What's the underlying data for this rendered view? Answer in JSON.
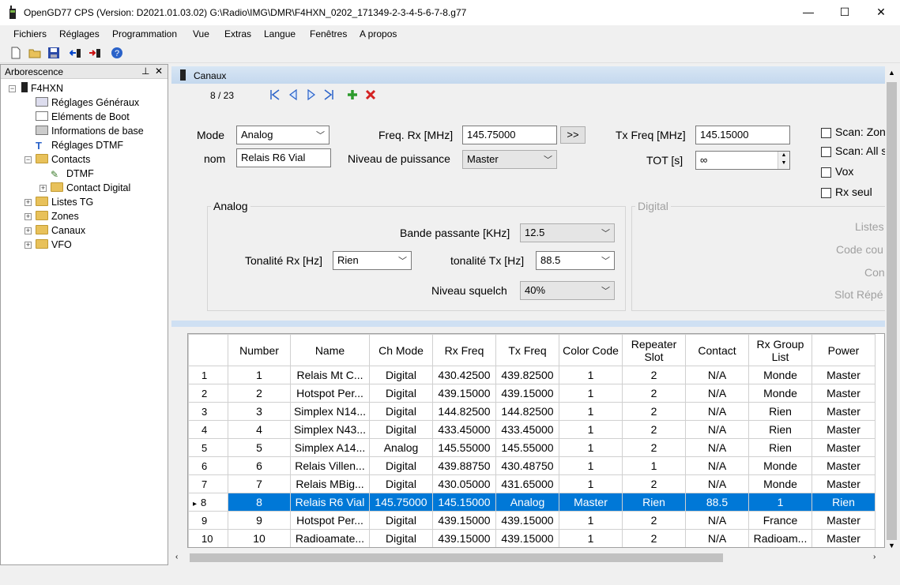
{
  "window": {
    "title": "OpenGD77 CPS (Version:  D2021.01.03.02) G:\\Radio\\IMG\\DMR\\F4HXN_0202_171349-2-3-4-5-6-7-8.g77",
    "minimize": "—",
    "maximize": "☐",
    "close": "✕"
  },
  "menu": [
    "Fichiers",
    "Réglages",
    "Programmation",
    "Vue",
    "Extras",
    "Langue",
    "Fenêtres",
    "A propos"
  ],
  "tree": {
    "header": "Arborescence",
    "pin": "𝟭",
    "close": "✕",
    "root": "F4HXN",
    "items": [
      "Réglages Généraux",
      "Eléments de Boot",
      "Informations de base",
      "Réglages DTMF",
      "Contacts",
      "DTMF",
      "Contact Digital",
      "Listes TG",
      "Zones",
      "Canaux",
      "VFO"
    ]
  },
  "canaux": {
    "title": "Canaux",
    "position": "8 / 23"
  },
  "form": {
    "mode_label": "Mode",
    "mode_value": "Analog",
    "nom_label": "nom",
    "nom_value": "Relais R6 Vial",
    "freq_rx_label": "Freq. Rx [MHz]",
    "freq_rx_value": "145.75000",
    "copy_button": ">>",
    "power_label": "Niveau de puissance",
    "power_value": "Master",
    "tx_freq_label": "Tx Freq [MHz]",
    "tx_freq_value": "145.15000",
    "tot_label": "TOT [s]",
    "tot_value": "∞",
    "scan_zone": "Scan: Zon",
    "scan_all": "Scan: All s",
    "vox": "Vox",
    "rx_seul": "Rx seul",
    "analog_group": "Analog",
    "bandwidth_label": "Bande passante [KHz]",
    "bandwidth_value": "12.5",
    "rx_tone_label": "Tonalité Rx [Hz]",
    "rx_tone_value": "Rien",
    "tx_tone_label": "tonalité Tx [Hz]",
    "tx_tone_value": "88.5",
    "squelch_label": "Niveau squelch",
    "squelch_value": "40%",
    "digital_group": "Digital",
    "listes": "Listes",
    "code_couleur": "Code cou",
    "contact": "Con",
    "slot": "Slot Répé"
  },
  "grid": {
    "columns": [
      "",
      "Number",
      "Name",
      "Ch Mode",
      "Rx Freq",
      "Tx Freq",
      "Color Code",
      "Repeater Slot",
      "Contact",
      "Rx Group List",
      "Power"
    ],
    "rows": [
      [
        "1",
        "1",
        "Relais Mt C...",
        "Digital",
        "430.42500",
        "439.82500",
        "1",
        "2",
        "N/A",
        "Monde",
        "Master"
      ],
      [
        "2",
        "2",
        "Hotspot Per...",
        "Digital",
        "439.15000",
        "439.15000",
        "1",
        "2",
        "N/A",
        "Monde",
        "Master"
      ],
      [
        "3",
        "3",
        "Simplex N14...",
        "Digital",
        "144.82500",
        "144.82500",
        "1",
        "2",
        "N/A",
        "Rien",
        "Master"
      ],
      [
        "4",
        "4",
        "Simplex N43...",
        "Digital",
        "433.45000",
        "433.45000",
        "1",
        "2",
        "N/A",
        "Rien",
        "Master"
      ],
      [
        "5",
        "5",
        "Simplex A14...",
        "Analog",
        "145.55000",
        "145.55000",
        "1",
        "2",
        "N/A",
        "Rien",
        "Master"
      ],
      [
        "6",
        "6",
        "Relais Villen...",
        "Digital",
        "439.88750",
        "430.48750",
        "1",
        "1",
        "N/A",
        "Monde",
        "Master"
      ],
      [
        "7",
        "7",
        "Relais MBig...",
        "Digital",
        "430.05000",
        "431.65000",
        "1",
        "2",
        "N/A",
        "Monde",
        "Master"
      ],
      [
        "8",
        "8",
        "Relais R6 Vial",
        "145.75000",
        "145.15000",
        "Analog",
        "Master",
        "Rien",
        "88.5",
        "1",
        "Rien"
      ],
      [
        "9",
        "9",
        "Hotspot Per...",
        "Digital",
        "439.15000",
        "439.15000",
        "1",
        "2",
        "N/A",
        "France",
        "Master"
      ],
      [
        "10",
        "10",
        "Radioamate...",
        "Digital",
        "439.15000",
        "439.15000",
        "1",
        "2",
        "N/A",
        "Radioam...",
        "Master"
      ]
    ],
    "selected_row_marker": "▸",
    "selected_index": 7
  },
  "colors": {
    "selection": "#0078d7",
    "header_gradient": "#c4d8ee"
  },
  "icons": [
    "new-file-icon",
    "open-folder-icon",
    "save-icon",
    "read-radio-icon",
    "write-radio-icon",
    "help-icon",
    "radio-icon",
    "first-icon",
    "prev-icon",
    "next-icon",
    "last-icon",
    "add-icon",
    "delete-icon"
  ]
}
